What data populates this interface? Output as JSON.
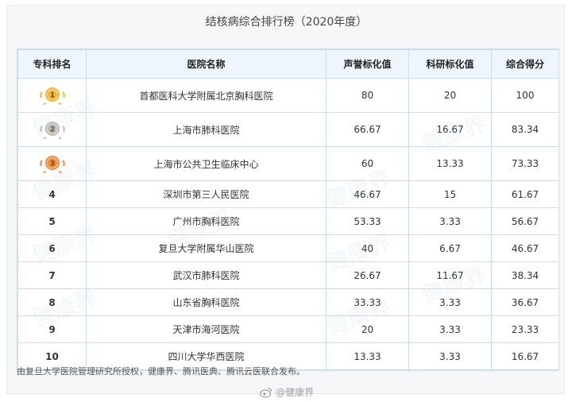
{
  "title": "结核病综合排行榜（2020年度）",
  "headers": [
    "专科排名",
    "医院名称",
    "声誉标化值",
    "科研标化值",
    "综合得分"
  ],
  "rows": [
    {
      "rank": "1",
      "name": "首都医科大学附属北京胸科医院",
      "reputation": "80",
      "research": "20",
      "score": "100"
    },
    {
      "rank": "2",
      "name": "上海市肺科医院",
      "reputation": "66.67",
      "research": "16.67",
      "score": "83.34"
    },
    {
      "rank": "3",
      "name": "上海市公共卫生临床中心",
      "reputation": "60",
      "research": "13.33",
      "score": "73.33"
    },
    {
      "rank": "4",
      "name": "深圳市第三人民医院",
      "reputation": "46.67",
      "research": "15",
      "score": "61.67"
    },
    {
      "rank": "5",
      "name": "广州市胸科医院",
      "reputation": "53.33",
      "research": "3.33",
      "score": "56.67"
    },
    {
      "rank": "6",
      "name": "复旦大学附属华山医院",
      "reputation": "40",
      "research": "6.67",
      "score": "46.67"
    },
    {
      "rank": "7",
      "name": "武汉市肺科医院",
      "reputation": "26.67",
      "research": "11.67",
      "score": "38.34"
    },
    {
      "rank": "8",
      "name": "山东省胸科医院",
      "reputation": "33.33",
      "research": "3.33",
      "score": "36.67"
    },
    {
      "rank": "9",
      "name": "天津市海河医院",
      "reputation": "20",
      "research": "3.33",
      "score": "23.33"
    },
    {
      "rank": "10",
      "name": "四川大学华西医院",
      "reputation": "13.33",
      "research": "3.33",
      "score": "16.67"
    }
  ],
  "medals": {
    "gold": "#f5b43a",
    "silver": "#bdbdbd",
    "bronze": "#f08a3c"
  },
  "footer": "由复旦大学医院管理研究所授权，健康界、腾讯医典、腾讯云医联合发布。",
  "weibo": "@健康界",
  "watermark": "健康界"
}
